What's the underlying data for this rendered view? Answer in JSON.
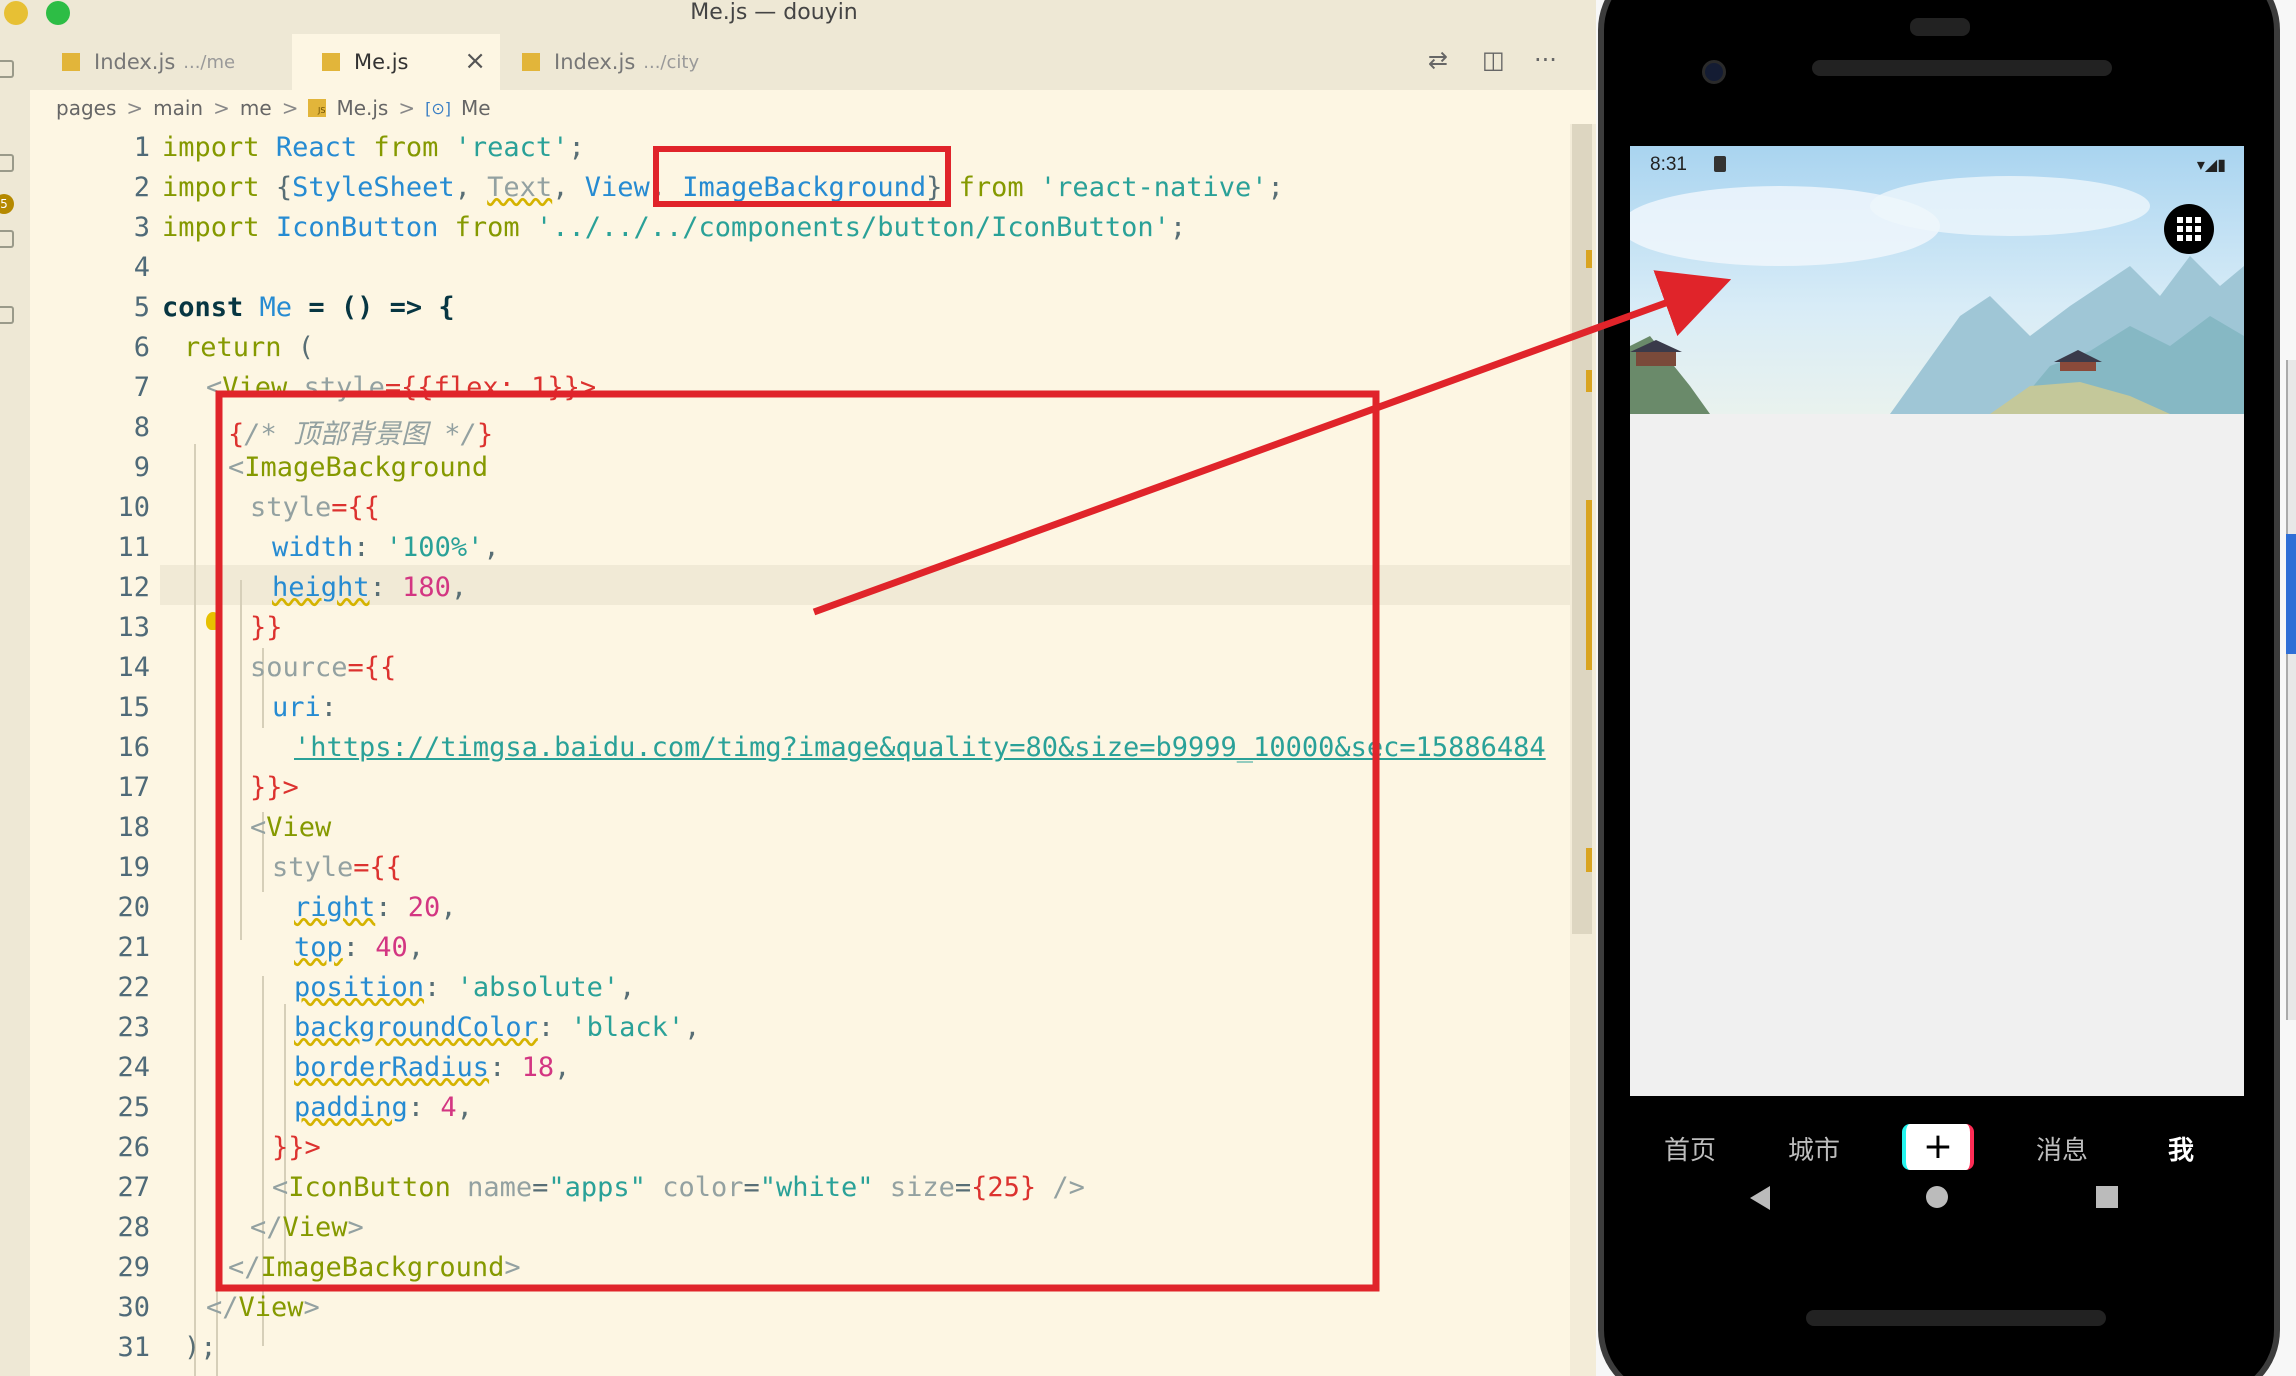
{
  "window": {
    "title": "Me.js — douyin"
  },
  "activity": {
    "badge": "5"
  },
  "tabs": [
    {
      "label": "Index.js",
      "path": ".../me"
    },
    {
      "label": "Me.js",
      "close": "×"
    },
    {
      "label": "Index.js",
      "path": ".../city"
    }
  ],
  "toolbar": {
    "compare_icon": "⇄",
    "split_icon": "◫",
    "more_icon": "···"
  },
  "breadcrumb": [
    "pages",
    "main",
    "me",
    "Me.js",
    "Me"
  ],
  "breadcrumb_sep": ">",
  "breadcrumb_file_icon": "JS",
  "breadcrumb_symbol_icon": "[⊙]",
  "line_numbers": [
    "1",
    "2",
    "3",
    "4",
    "5",
    "6",
    "7",
    "8",
    "9",
    "10",
    "11",
    "12",
    "13",
    "14",
    "15",
    "16",
    "17",
    "18",
    "19",
    "20",
    "21",
    "22",
    "23",
    "24",
    "25",
    "26",
    "27",
    "28",
    "29",
    "30",
    "31"
  ],
  "code": {
    "l1": {
      "kw": "import",
      "name": "React",
      "from": "from",
      "str": "'react'",
      "semi": ";"
    },
    "l2": {
      "kw": "import",
      "open": "{",
      "a": "StyleSheet",
      "b": "Text",
      "c": "View",
      "d": "ImageBackground",
      "close": "}",
      "from": "from",
      "str": "'react-native'",
      "semi": ";"
    },
    "l3": {
      "kw": "import",
      "name": "IconButton",
      "from": "from",
      "str": "'../../../components/button/IconButton'",
      "semi": ";"
    },
    "l5": {
      "kw": "const",
      "name": "Me",
      "rest": " = () => {"
    },
    "l6": {
      "kw": "return",
      "rest": " ("
    },
    "l7": {
      "open": "<",
      "tag": "View",
      "attr": "style",
      "val": "={{flex: 1}}>"
    },
    "l8": {
      "open": "{",
      "comment": "/* 顶部背景图 */",
      "close": "}"
    },
    "l9": {
      "open": "<",
      "tag": "ImageBackground"
    },
    "l10": {
      "attr": "style",
      "val": "={{"
    },
    "l11": {
      "prop": "width",
      "val": "'100%'"
    },
    "l12": {
      "prop": "height",
      "val": "180"
    },
    "l13": {
      "text": "}}"
    },
    "l14": {
      "attr": "source",
      "val": "={{"
    },
    "l15": {
      "prop": "uri"
    },
    "l16": {
      "val": "'https://timgsa.baidu.com/timg?image&quality=80&size=b9999_10000&sec=15886484"
    },
    "l17": {
      "text": "}}>"
    },
    "l18": {
      "open": "<",
      "tag": "View"
    },
    "l19": {
      "attr": "style",
      "val": "={{"
    },
    "l20": {
      "prop": "right",
      "val": "20"
    },
    "l21": {
      "prop": "top",
      "val": "40"
    },
    "l22": {
      "prop": "position",
      "val": "'absolute'"
    },
    "l23": {
      "prop": "backgroundColor",
      "val": "'black'"
    },
    "l24": {
      "prop": "borderRadius",
      "val": "18"
    },
    "l25": {
      "prop": "padding",
      "val": "4"
    },
    "l26": {
      "text": "}}>"
    },
    "l27": {
      "open": "<",
      "tag": "IconButton",
      "a1": "name",
      "v1": "\"apps\"",
      "a2": "color",
      "v2": "\"white\"",
      "a3": "size",
      "v3": "{25}",
      "end": " />"
    },
    "l28": {
      "text": "</",
      "tag": "View",
      "end": ">"
    },
    "l29": {
      "text": "</",
      "tag": "ImageBackground",
      "end": ">"
    },
    "l30": {
      "text": "</",
      "tag": "View",
      "end": ">"
    },
    "l31": {
      "text": ");"
    }
  },
  "phone": {
    "status": {
      "time": "8:31",
      "icons": "▾◢▮"
    },
    "tabs": [
      "首页",
      "城市",
      "+",
      "消息",
      "我"
    ],
    "active_tab": "我"
  },
  "colors": {
    "editor_bg": "#fdf6e3",
    "annotation_red": "#e0242a",
    "keyword": "#859900",
    "identifier": "#268bd2",
    "string": "#2aa198",
    "number": "#d33682"
  }
}
